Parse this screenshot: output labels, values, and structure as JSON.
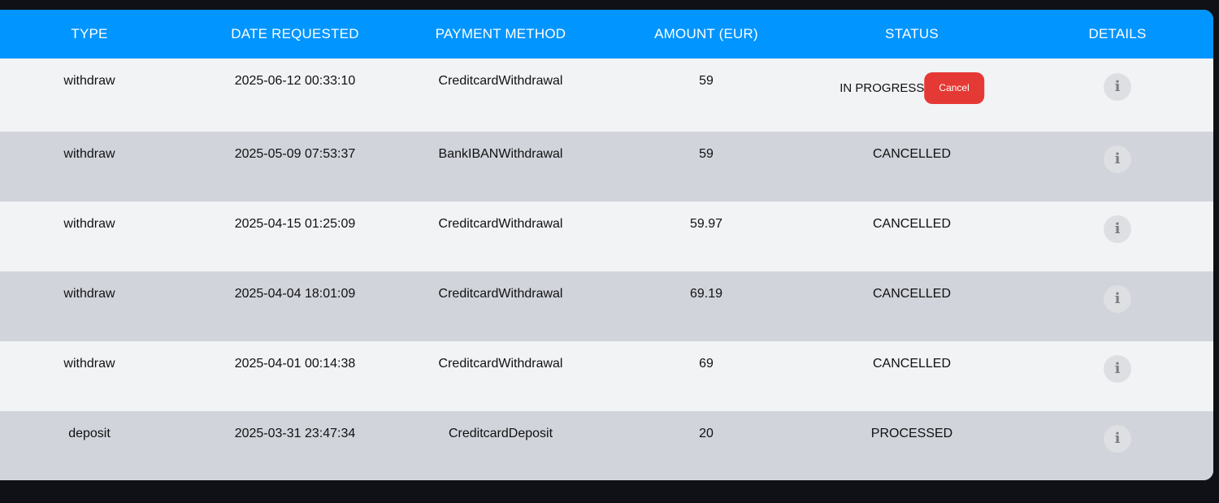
{
  "table": {
    "headers": [
      "TYPE",
      "DATE REQUESTED",
      "PAYMENT METHOD",
      "AMOUNT (EUR)",
      "STATUS",
      "DETAILS"
    ],
    "rows": [
      {
        "type": "withdraw",
        "date": "2025-06-12 00:33:10",
        "method": "CreditcardWithdrawal",
        "amount": "59",
        "status": "IN PROGRESS",
        "action": "Cancel"
      },
      {
        "type": "withdraw",
        "date": "2025-05-09 07:53:37",
        "method": "BankIBANWithdrawal",
        "amount": "59",
        "status": "CANCELLED"
      },
      {
        "type": "withdraw",
        "date": "2025-04-15 01:25:09",
        "method": "CreditcardWithdrawal",
        "amount": "59.97",
        "status": "CANCELLED"
      },
      {
        "type": "withdraw",
        "date": "2025-04-04 18:01:09",
        "method": "CreditcardWithdrawal",
        "amount": "69.19",
        "status": "CANCELLED"
      },
      {
        "type": "withdraw",
        "date": "2025-04-01 00:14:38",
        "method": "CreditcardWithdrawal",
        "amount": "69",
        "status": "CANCELLED"
      },
      {
        "type": "deposit",
        "date": "2025-03-31 23:47:34",
        "method": "CreditcardDeposit",
        "amount": "20",
        "status": "PROCESSED"
      }
    ],
    "details_icon": "info-icon",
    "colors": {
      "header_bg": "#0095ff",
      "row_light": "#f2f3f5",
      "row_dark": "#d1d4db",
      "cancel_button": "#e53935",
      "page_bg": "#0f1116"
    }
  }
}
